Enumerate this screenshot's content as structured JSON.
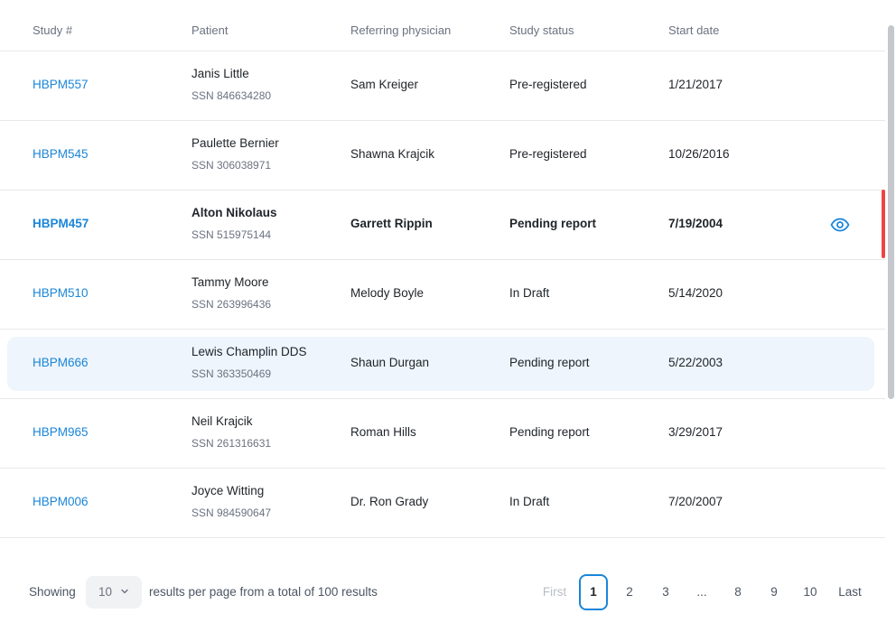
{
  "table": {
    "headers": {
      "study": "Study #",
      "patient": "Patient",
      "physician": "Referring physician",
      "status": "Study status",
      "date": "Start date"
    },
    "rows": [
      {
        "study": "HBPM557",
        "patient": "Janis Little",
        "ssn": "SSN 846634280",
        "physician": "Sam Kreiger",
        "status": "Pre-registered",
        "date": "1/21/2017"
      },
      {
        "study": "HBPM545",
        "patient": "Paulette Bernier",
        "ssn": "SSN 306038971",
        "physician": "Shawna Krajcik",
        "status": "Pre-registered",
        "date": "10/26/2016"
      },
      {
        "study": "HBPM457",
        "patient": "Alton Nikolaus",
        "ssn": "SSN 515975144",
        "physician": "Garrett Rippin",
        "status": "Pending report",
        "date": "7/19/2004",
        "selected": true,
        "action_icon": "eye-icon"
      },
      {
        "study": "HBPM510",
        "patient": "Tammy Moore",
        "ssn": "SSN 263996436",
        "physician": "Melody Boyle",
        "status": "In Draft",
        "date": "5/14/2020"
      },
      {
        "study": "HBPM666",
        "patient": "Lewis Champlin DDS",
        "ssn": "SSN 363350469",
        "physician": "Shaun Durgan",
        "status": "Pending report",
        "date": "5/22/2003",
        "hovered": true
      },
      {
        "study": "HBPM965",
        "patient": "Neil Krajcik",
        "ssn": "SSN 261316631",
        "physician": "Roman Hills",
        "status": "Pending report",
        "date": "3/29/2017"
      },
      {
        "study": "HBPM006",
        "patient": "Joyce Witting",
        "ssn": "SSN 984590647",
        "physician": "Dr. Ron Grady",
        "status": "In Draft",
        "date": "7/20/2007"
      }
    ]
  },
  "footer": {
    "showing": "Showing",
    "per_page_value": "10",
    "results_text": "results per page from a total of 100 results",
    "pagination": {
      "first": "First",
      "pages": [
        "1",
        "2",
        "3",
        "...",
        "8",
        "9",
        "10"
      ],
      "active_page": "1",
      "last": "Last"
    }
  },
  "colors": {
    "link": "#1a86d9",
    "selected_indicator": "#ef4444",
    "hover_row": "#eef5fc"
  }
}
